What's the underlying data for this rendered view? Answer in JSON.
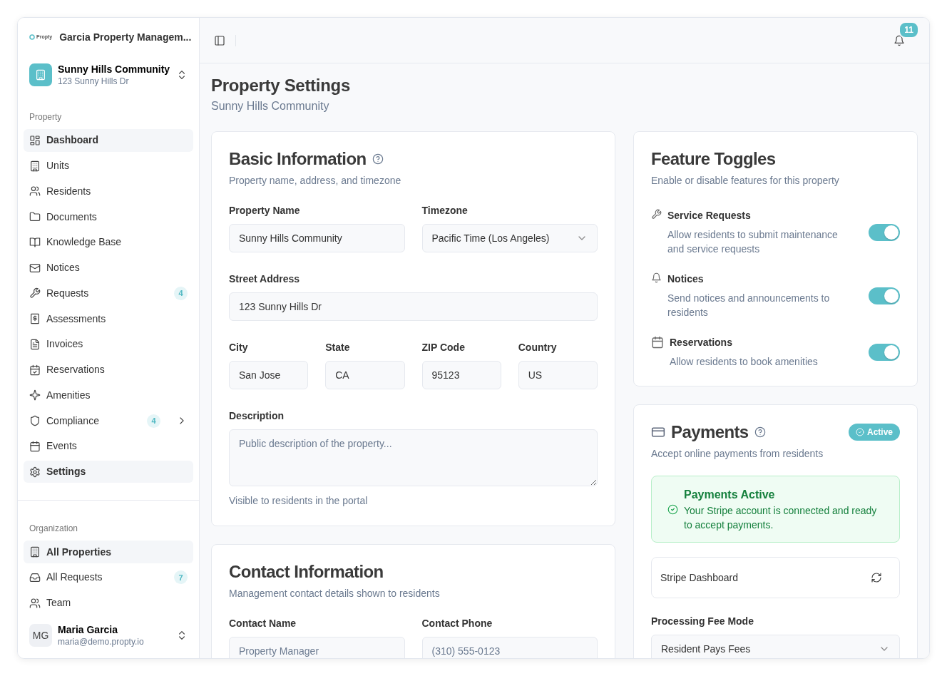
{
  "sidebar": {
    "logo_text": "Propty",
    "org_name": "Garcia Property Managem...",
    "property": {
      "name": "Sunny Hills Community",
      "address": "123 Sunny Hills Dr"
    },
    "sections": [
      {
        "title": "Property",
        "items": [
          {
            "label": "Dashboard",
            "selected": true
          },
          {
            "label": "Units",
            "selected": false
          },
          {
            "label": "Residents",
            "selected": false
          },
          {
            "label": "Documents",
            "selected": false
          },
          {
            "label": "Knowledge Base",
            "selected": false
          },
          {
            "label": "Notices",
            "selected": false
          },
          {
            "label": "Requests",
            "selected": false,
            "badge": "4"
          },
          {
            "label": "Assessments",
            "selected": false
          },
          {
            "label": "Invoices",
            "selected": false
          },
          {
            "label": "Reservations",
            "selected": false
          },
          {
            "label": "Amenities",
            "selected": false
          },
          {
            "label": "Compliance",
            "selected": false,
            "badge": "4",
            "kind": "group"
          },
          {
            "label": "Events",
            "selected": false
          },
          {
            "label": "Settings",
            "selected": true
          }
        ]
      },
      {
        "title": "Organization",
        "items": [
          {
            "label": "All Properties",
            "selected": true
          },
          {
            "label": "All Requests",
            "selected": false,
            "badge": "7"
          },
          {
            "label": "Team",
            "selected": false
          }
        ]
      }
    ],
    "user": {
      "initials": "MG",
      "name": "Maria Garcia",
      "email": "maria@demo.propty.io"
    }
  },
  "topbar": {
    "notification_count": "11"
  },
  "page": {
    "title": "Property Settings",
    "subtitle": "Sunny Hills Community"
  },
  "basic_info": {
    "title": "Basic Information",
    "subtitle": "Property name, address, and timezone",
    "field_groups": [
      {
        "fields": [
          {
            "label": "Property Name",
            "kind": "text",
            "value": "Sunny Hills Community"
          },
          {
            "label": "Timezone",
            "kind": "select",
            "value": "Pacific Time (Los Angeles)"
          }
        ]
      },
      {
        "fields": [
          {
            "label": "Street Address",
            "kind": "text",
            "value": "123 Sunny Hills Dr"
          }
        ]
      },
      {
        "fields": [
          {
            "label": "City",
            "kind": "text",
            "value": "San Jose"
          },
          {
            "label": "State",
            "kind": "text",
            "value": "CA"
          },
          {
            "label": "ZIP Code",
            "kind": "text",
            "value": "95123"
          },
          {
            "label": "Country",
            "kind": "text",
            "value": "US"
          }
        ]
      },
      {
        "fields": [
          {
            "label": "Description",
            "kind": "textarea",
            "placeholder": "Public description of the property...",
            "hint": "Visible to residents in the portal"
          }
        ]
      }
    ]
  },
  "contact_info": {
    "title": "Contact Information",
    "subtitle": "Management contact details shown to residents",
    "field_groups": [
      {
        "fields": [
          {
            "label": "Contact Name",
            "kind": "text",
            "placeholder": "Property Manager"
          },
          {
            "label": "Contact Phone",
            "kind": "text",
            "placeholder": "(310) 555-0123"
          }
        ]
      }
    ]
  },
  "feature_toggles": {
    "title": "Feature Toggles",
    "subtitle": "Enable or disable features for this property",
    "items": [
      {
        "name": "Service Requests",
        "description": "Allow residents to submit maintenance and service requests",
        "on": true
      },
      {
        "name": "Notices",
        "description": "Send notices and announcements to residents",
        "on": true
      },
      {
        "name": "Reservations",
        "description": "Allow residents to book amenities",
        "on": true
      }
    ]
  },
  "payments": {
    "title": "Payments",
    "subtitle": "Accept online payments from residents",
    "status_badge": "Active",
    "alert": {
      "title": "Payments Active",
      "message": "Your Stripe account is connected and ready to accept payments."
    },
    "stripe_link": "Stripe Dashboard",
    "fee_mode": {
      "label": "Processing Fee Mode",
      "value": "Resident Pays Fees"
    }
  }
}
